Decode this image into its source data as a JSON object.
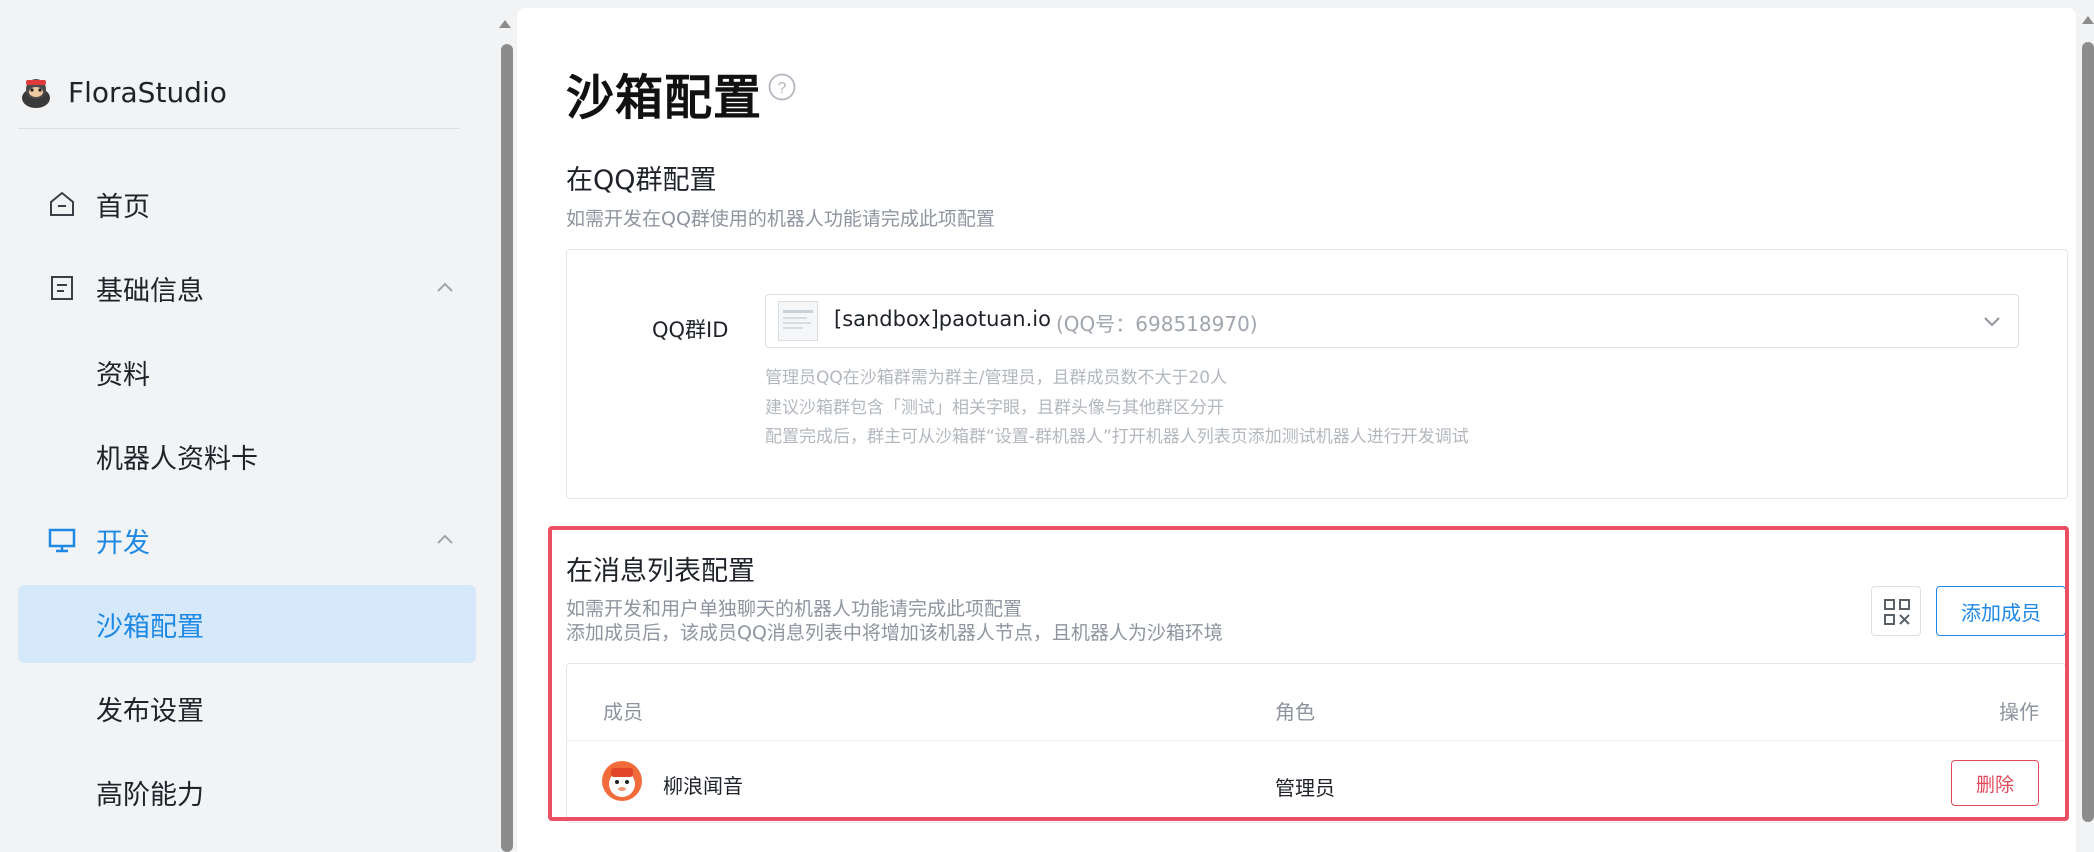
{
  "brand": {
    "name": "FloraStudio"
  },
  "sidebar": {
    "items": [
      {
        "label": "首页",
        "icon": "home-icon"
      },
      {
        "label": "基础信息",
        "icon": "document-icon"
      },
      {
        "label": "资料"
      },
      {
        "label": "机器人资料卡"
      },
      {
        "label": "开发",
        "icon": "monitor-icon"
      },
      {
        "label": "沙箱配置"
      },
      {
        "label": "发布设置"
      },
      {
        "label": "高阶能力"
      }
    ]
  },
  "page": {
    "title": "沙箱配置"
  },
  "qq_group": {
    "title": "在QQ群配置",
    "description": "如需开发在QQ群使用的机器人功能请完成此项配置",
    "field_label": "QQ群ID",
    "selected_name": "[sandbox]paotuan.io",
    "selected_number": "(QQ号：698518970)",
    "hints": [
      "管理员QQ在沙箱群需为群主/管理员，且群成员数不大于20人",
      "建议沙箱群包含「测试」相关字眼，且群头像与其他群区分开",
      "配置完成后，群主可从沙箱群“设置-群机器人”打开机器人列表页添加测试机器人进行开发调试"
    ]
  },
  "message_list": {
    "title": "在消息列表配置",
    "description_1": "如需开发和用户单独聊天的机器人功能请完成此项配置",
    "description_2": "添加成员后，该成员QQ消息列表中将增加该机器人节点，且机器人为沙箱环境",
    "add_member_label": "添加成员",
    "table": {
      "headers": {
        "member": "成员",
        "role": "角色",
        "action": "操作"
      },
      "rows": [
        {
          "name": "柳浪闻音",
          "role": "管理员",
          "action": "删除"
        }
      ]
    }
  },
  "colors": {
    "accent": "#1e88e5",
    "selected_bg": "#d6e9fb",
    "highlight_border": "#eb4f64",
    "danger": "#e24a5c"
  }
}
